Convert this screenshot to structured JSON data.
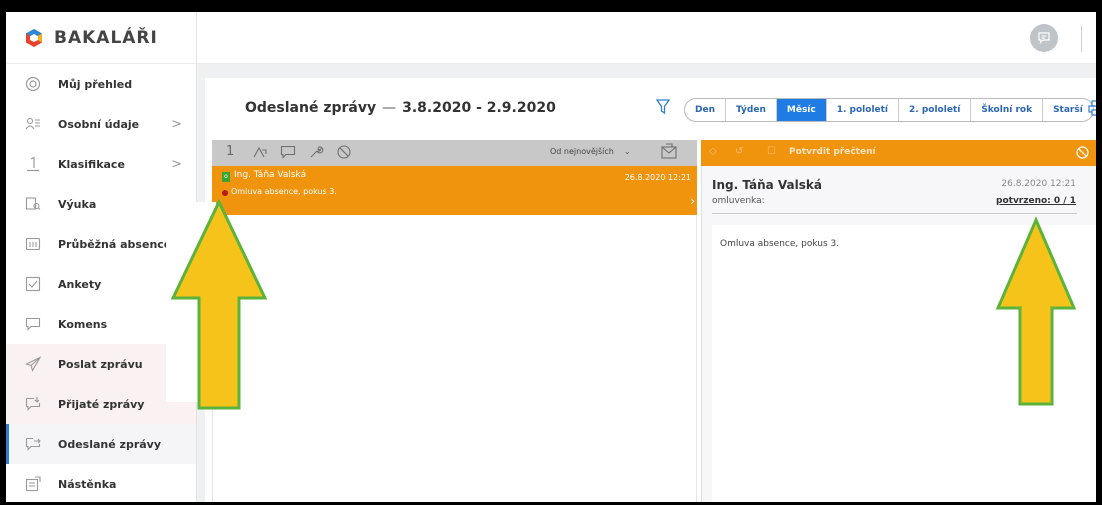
{
  "app": {
    "logo_text": "BAKALÁŘI"
  },
  "sidebar": {
    "items": [
      {
        "label": "Můj přehled",
        "icon": "overview-icon"
      },
      {
        "label": "Osobní údaje",
        "icon": "personal-data-icon",
        "has_submenu": true
      },
      {
        "label": "Klasifikace",
        "icon": "grades-icon",
        "has_submenu": true
      },
      {
        "label": "Výuka",
        "icon": "teaching-icon"
      },
      {
        "label": "Průběžná absence",
        "icon": "absence-icon"
      },
      {
        "label": "Ankety",
        "icon": "survey-icon"
      },
      {
        "label": "Komens",
        "icon": "komens-icon"
      },
      {
        "label": "Poslat zprávu",
        "icon": "send-message-icon"
      },
      {
        "label": "Přijaté zprávy",
        "icon": "received-messages-icon"
      },
      {
        "label": "Odeslané zprávy",
        "icon": "sent-messages-icon",
        "active": true
      },
      {
        "label": "Nástěnka",
        "icon": "noticeboard-icon"
      }
    ]
  },
  "page": {
    "title": "Odeslané zprávy",
    "title_dash": "—",
    "date_range": "3.8.2020 - 2.9.2020"
  },
  "periods": [
    {
      "label": "Den"
    },
    {
      "label": "Týden"
    },
    {
      "label": "Měsíc",
      "selected": true
    },
    {
      "label": "1. pololetí"
    },
    {
      "label": "2. pololetí"
    },
    {
      "label": "Školní rok"
    },
    {
      "label": "Starší"
    }
  ],
  "list_toolbar": {
    "count_label": "1",
    "sort_label": "Od nejnovějších",
    "sort_caret": "⌄"
  },
  "message": {
    "sender": "Ing. Táňa Valská",
    "badge": "o",
    "date": "26.8.2020 12:21",
    "snippet": "Omluva absence, pokus 3.",
    "open_chevron": "›"
  },
  "detail_toolbar": {
    "confirm_label": "Potvrdit přečtení"
  },
  "detail": {
    "sender": "Ing. Táňa Valská",
    "date": "26.8.2020 12:21",
    "type_label": "omluvenka:",
    "confirmed_label": "potvrzeno: 0 / 1",
    "body": "Omluva absence, pokus 3."
  },
  "colors": {
    "accent_orange": "#f0930d",
    "accent_blue": "#1f7ce2",
    "arrow_fill": "#f6c31b",
    "arrow_stroke": "#5cb33a"
  }
}
